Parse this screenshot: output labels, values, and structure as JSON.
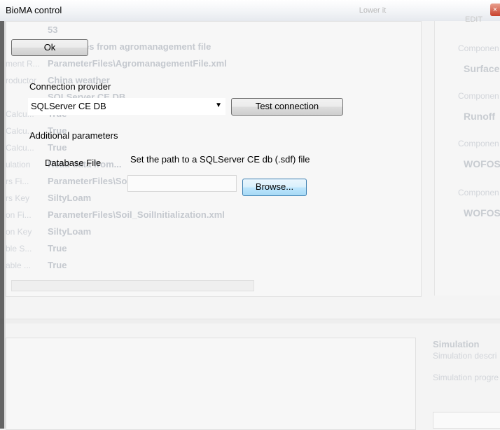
{
  "window": {
    "title": "BioMA control",
    "close_glyph": "×",
    "bg_tab_label": "Lower it",
    "bg_right_label": "EDIT"
  },
  "background": {
    "rows": [
      {
        "key": "",
        "value": "53"
      },
      {
        "key": "",
        "value": "Read rules from agromanagement file"
      },
      {
        "key": "ment R...",
        "value": "ParameterFiles\\AgromanagementFile.xml"
      },
      {
        "key": "roductor",
        "value": "China weather"
      },
      {
        "key": "",
        "value": "SQLServer CE DB"
      },
      {
        "key": "Calcu...",
        "value": "True"
      },
      {
        "key": "Calcu...",
        "value": "True"
      },
      {
        "key": "Calcu...",
        "value": "True"
      },
      {
        "key": "ulation",
        "value": "Read data from..."
      },
      {
        "key": "rs Fi...",
        "value": "ParameterFiles\\Soil_SoilParameters.xml"
      },
      {
        "key": "rs Key",
        "value": "SiltyLoam"
      },
      {
        "key": "on Fi...",
        "value": "ParameterFiles\\Soil_SoilInitialization.xml"
      },
      {
        "key": "on Key",
        "value": "SiltyLoam"
      },
      {
        "key": "ble S...",
        "value": "True"
      },
      {
        "key": "able ...",
        "value": "True"
      }
    ],
    "components": [
      {
        "label": "Componen",
        "value": "Surface"
      },
      {
        "label": "Componen",
        "value": "Runoff"
      },
      {
        "label": "Componen",
        "value": "WOFOS"
      },
      {
        "label": "Componen",
        "value": "WOFOS"
      }
    ],
    "simulation": {
      "title": "Simulation",
      "description": "Simulation descri",
      "progress": "Simulation progre"
    }
  },
  "dialog": {
    "ok_label": "Ok",
    "connection_provider_label": "Connection provider",
    "provider_value": "SQLServer CE DB",
    "test_connection_label": "Test connection",
    "additional_parameters_label": "Additional parameters",
    "database_file_label": "Database File",
    "path_hint": "Set the path to a SQLServer CE db (.sdf) file",
    "path_value": "",
    "browse_label": "Browse..."
  }
}
